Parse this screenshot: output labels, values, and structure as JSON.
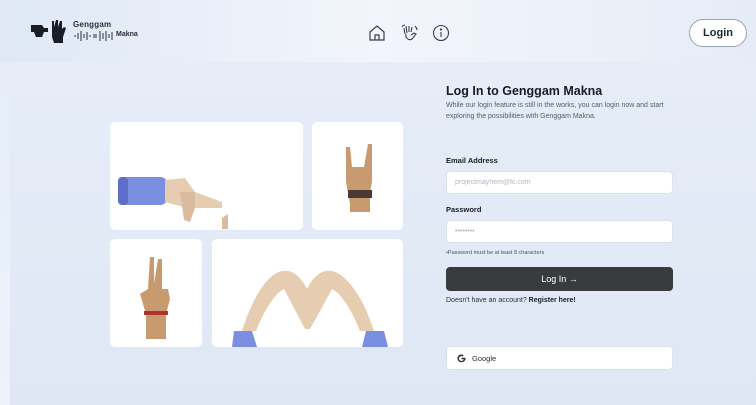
{
  "header": {
    "logo": {
      "name_top": "Genggam",
      "name_bottom": "Makna"
    },
    "nav": [
      {
        "icon": "home-icon",
        "label": "Home"
      },
      {
        "icon": "hand-wave-icon",
        "label": "Sign"
      },
      {
        "icon": "info-icon",
        "label": "Info"
      }
    ],
    "login_label": "Login"
  },
  "form": {
    "title": "Log In to Genggam Makna",
    "description": "While our login feature is still in the works, you can login now and start exploring the possibilities with Genggam Makna.",
    "email_label": "Email Address",
    "email_placeholder": "projectmayhem@fc.com",
    "password_label": "Password",
    "password_placeholder": "••••••••",
    "password_hint": "•Password must be at least 8 characters",
    "submit_label": "Log In →",
    "register_prefix": "Doesn't have an account? ",
    "register_link": "Register here!",
    "google_label": "Google"
  },
  "colors": {
    "background": "#e4ecf8",
    "button_dark": "#3a3b3f",
    "sleeve": "#7b8fe0",
    "skin": "#e6ccb0"
  }
}
